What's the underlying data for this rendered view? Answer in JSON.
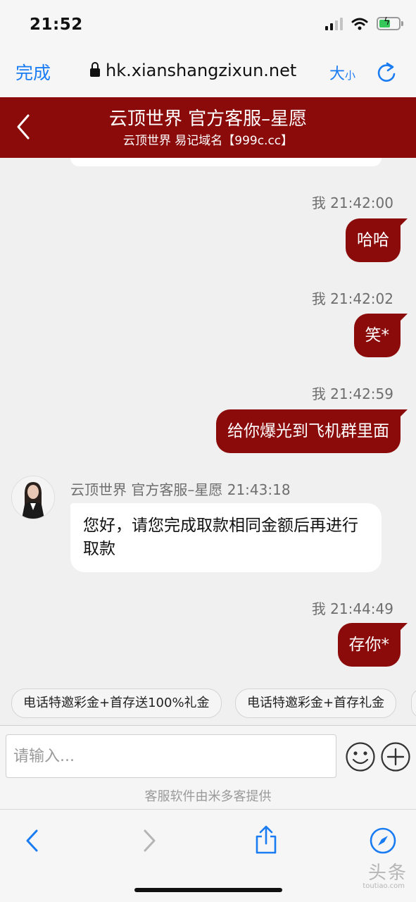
{
  "status_bar": {
    "time": "21:52"
  },
  "browser": {
    "done_label": "完成",
    "url": "hk.xianshangzixun.net",
    "text_size_big": "大",
    "text_size_small": "小"
  },
  "header": {
    "title": "云顶世界 官方客服–星愿",
    "subtitle": "云顶世界 易记域名【999c.cc】"
  },
  "messages": [
    {
      "sender": "我",
      "time": "21:42:00",
      "text": "哈哈",
      "side": "right"
    },
    {
      "sender": "我",
      "time": "21:42:02",
      "text": "笑*",
      "side": "right"
    },
    {
      "sender": "我",
      "time": "21:42:59",
      "text": "给你爆光到飞机群里面",
      "side": "right"
    },
    {
      "sender": "云顶世界 官方客服–星愿",
      "time": "21:43:18",
      "text": "您好，请您完成取款相同金额后再进行取款",
      "side": "left"
    },
    {
      "sender": "我",
      "time": "21:44:49",
      "text": "存你*",
      "side": "right"
    }
  ],
  "quick_replies": [
    "电话特邀彩金+首存送100%礼金",
    "电话特邀彩金+首存礼金"
  ],
  "composer": {
    "placeholder": "请输入...",
    "powered_by": "客服软件由米多客提供"
  },
  "watermark": {
    "text": "头条",
    "sub": "toutiao.com"
  },
  "colors": {
    "brand": "#8b0a0a",
    "link": "#1a7cf2",
    "background": "#f0f0f0"
  },
  "icons": [
    "lock-icon",
    "reload-icon",
    "back-chevron-icon",
    "emoji-icon",
    "plus-icon",
    "share-icon",
    "compass-icon"
  ]
}
